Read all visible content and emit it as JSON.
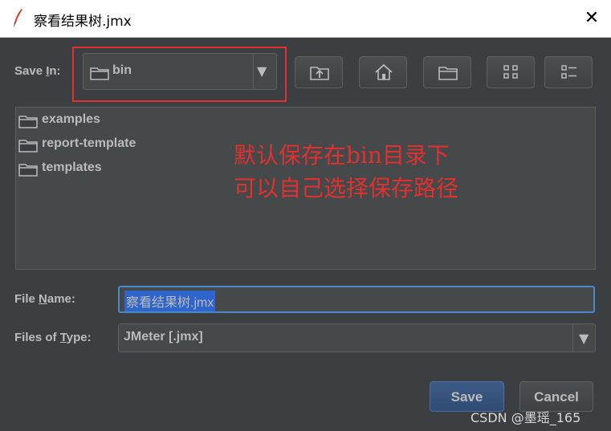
{
  "window": {
    "title": "察看结果树.jmx",
    "close_glyph": "✕"
  },
  "save_in": {
    "label_pre": "Save ",
    "label_key": "I",
    "label_post": "n:",
    "selected": "bin",
    "icon": "folder-icon"
  },
  "toolbar": {
    "buttons": [
      {
        "name": "up-one-level-button",
        "icon": "folder-up-icon"
      },
      {
        "name": "home-button",
        "icon": "home-icon"
      },
      {
        "name": "new-folder-button",
        "icon": "new-folder-icon"
      },
      {
        "name": "list-view-button",
        "icon": "list-view-icon"
      },
      {
        "name": "details-view-button",
        "icon": "details-view-icon"
      }
    ]
  },
  "file_list": {
    "items": [
      "examples",
      "report-template",
      "templates"
    ]
  },
  "annotation": {
    "line1": "默认保存在bin目录下",
    "line2": "可以自己选择保存路径",
    "color": "#e03030"
  },
  "file_name": {
    "label_pre": "File ",
    "label_key": "N",
    "label_post": "ame:",
    "value": "察看结果树.jmx"
  },
  "file_type": {
    "label_pre": "Files of ",
    "label_key": "T",
    "label_post": "ype:",
    "selected": "JMeter [.jmx]"
  },
  "actions": {
    "save_label": "Save",
    "cancel_label": "Cancel"
  },
  "watermark": "CSDN @墨瑶_165",
  "colors": {
    "background": "#3c3f41",
    "field": "#45494a",
    "border": "#5e6060",
    "text": "#bbbbbb",
    "selection": "#2f65ca",
    "focus": "#4a88c7",
    "highlight_box": "#e03030"
  }
}
